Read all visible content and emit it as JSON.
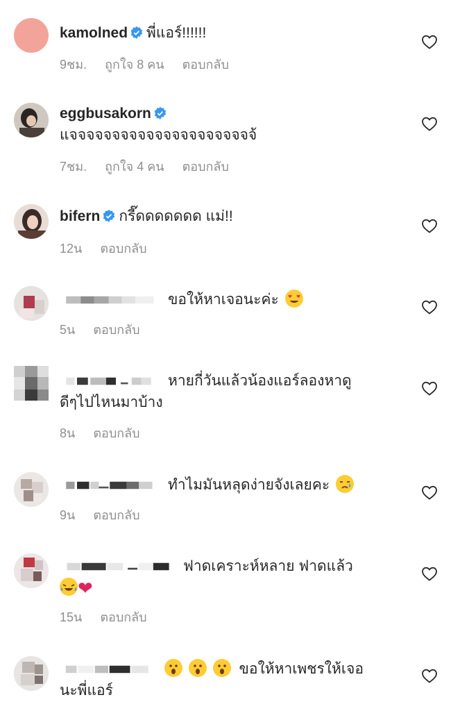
{
  "comments": [
    {
      "username": "kamolned",
      "text": "พี่แอร์!!!!!!",
      "time": "9ชม.",
      "likes": "ถูกใจ 8 คน",
      "reply": "ตอบกลับ"
    },
    {
      "username": "eggbusakorn",
      "text": "แจจจจจจจจจจจจจจจจจจจจจจ้",
      "time": "7ชม.",
      "likes": "ถูกใจ 4 คน",
      "reply": "ตอบกลับ"
    },
    {
      "username": "bifern",
      "text": "กรี๊ดดดดดดด แม่!!",
      "time": "12น",
      "reply": "ตอบกลับ"
    },
    {
      "text": "ขอให้หาเจอนะค่ะ",
      "time": "5น",
      "reply": "ตอบกลับ"
    },
    {
      "text_line1": "หายกี่วันแล้วน้องแอร์ลองหาดู",
      "text_line2": "ดีๆไปไหนมาบ้าง",
      "time": "8น",
      "reply": "ตอบกลับ"
    },
    {
      "text": "ทำไมมันหลุดง่ายจังเลยคะ",
      "time": "9น",
      "reply": "ตอบกลับ"
    },
    {
      "text": "ฟาดเคราะห์หลาย ฟาดแล้ว",
      "time": "15น",
      "reply": "ตอบกลับ"
    },
    {
      "text_line1": "ขอให้หาเพชรให้เจอ",
      "text_line2": "นะพี่แอร์"
    }
  ],
  "icons": {
    "verified": "verified-badge-icon",
    "like": "heart-outline-icon"
  },
  "colors": {
    "verified": "#3897f0",
    "muted": "#8e8e8e",
    "text": "#262626"
  }
}
